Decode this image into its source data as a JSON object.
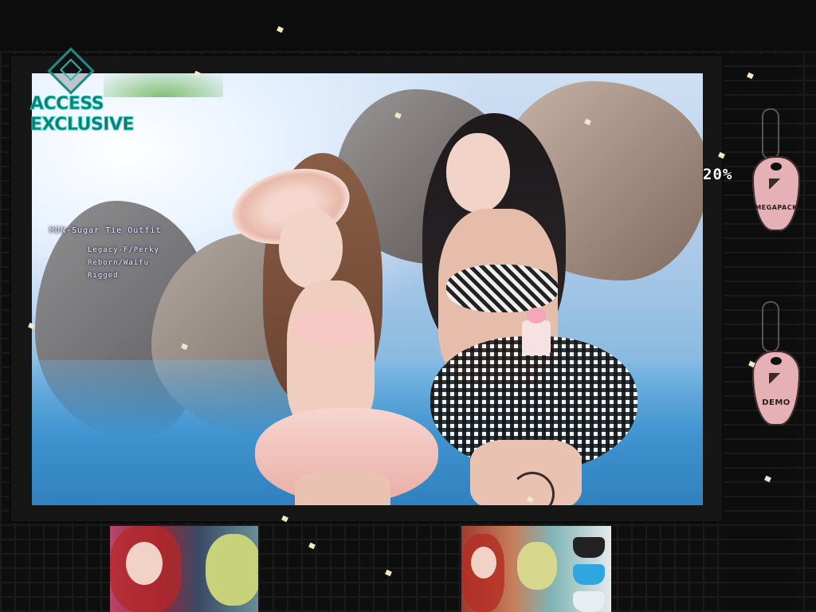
{
  "logo": {
    "line1": "ACCESS",
    "line2": "EXCLUSIVE",
    "color": "#1e8c86",
    "icon": "diamond-icon"
  },
  "product": {
    "title": "MON-Sugar Tie Outfit",
    "details": [
      "Legacy-F/Perky",
      "Reborn/Waifu",
      "Rigged"
    ]
  },
  "promo": {
    "discount": "20%"
  },
  "tags": {
    "megapack": "MEGAPACK",
    "demo": "DEMO"
  },
  "colors": {
    "tag_pink": "#e5b1b6",
    "background": "#0b0b0b"
  }
}
